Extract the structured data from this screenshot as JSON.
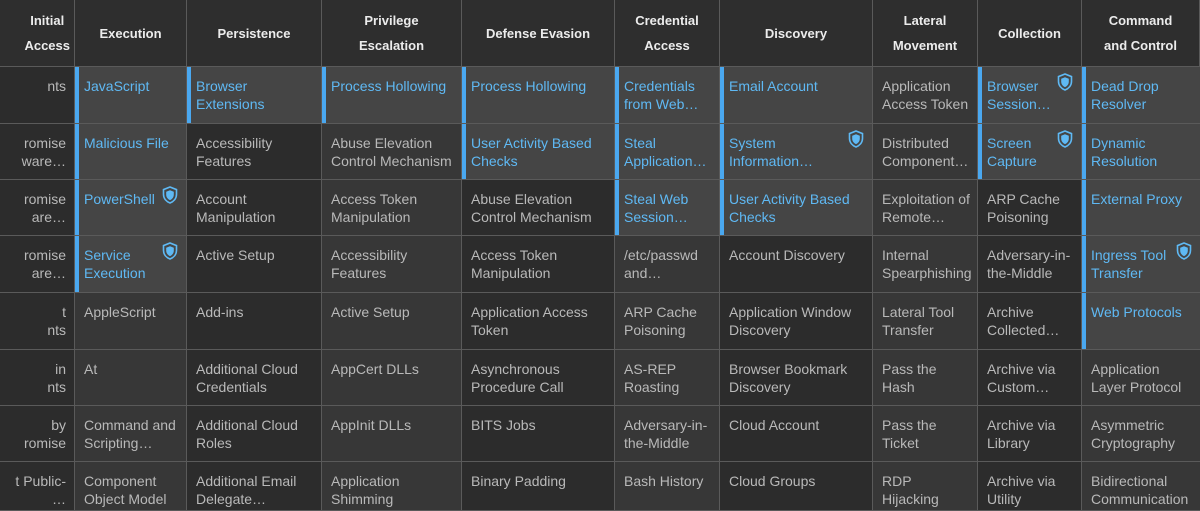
{
  "colors": {
    "highlight_text": "#5fb9f4",
    "highlight_bar": "#4aa8f0",
    "header_text": "#ececec",
    "cell_text": "#b9b9b9"
  },
  "headers": [
    "Initial\nAccess",
    "Execution",
    "Persistence",
    "Privilege\nEscalation",
    "Defense Evasion",
    "Credential\nAccess",
    "Discovery",
    "Lateral\nMovement",
    "Collection",
    "Command\nand Control"
  ],
  "rows": [
    {
      "cells": [
        {
          "text": "nts",
          "hl": false,
          "badge": false
        },
        {
          "text": "JavaScript",
          "hl": true,
          "badge": false
        },
        {
          "text": "Browser\nExtensions",
          "hl": true,
          "badge": false
        },
        {
          "text": "Process Hollowing",
          "hl": true,
          "badge": false
        },
        {
          "text": "Process Hollowing",
          "hl": true,
          "badge": false
        },
        {
          "text": "Credentials\nfrom Web…",
          "hl": true,
          "badge": false
        },
        {
          "text": "Email Account",
          "hl": true,
          "badge": false
        },
        {
          "text": "Application\nAccess Token",
          "hl": false,
          "badge": false
        },
        {
          "text": "Browser\nSession…",
          "hl": true,
          "badge": true
        },
        {
          "text": "Dead Drop\nResolver",
          "hl": true,
          "badge": false
        }
      ]
    },
    {
      "cells": [
        {
          "text": "romise\nware…",
          "hl": false,
          "badge": false
        },
        {
          "text": "Malicious File",
          "hl": true,
          "badge": false
        },
        {
          "text": "Accessibility\nFeatures",
          "hl": false,
          "badge": false
        },
        {
          "text": "Abuse Elevation\nControl Mechanism",
          "hl": false,
          "badge": false
        },
        {
          "text": "User Activity Based\nChecks",
          "hl": true,
          "badge": false
        },
        {
          "text": "Steal\nApplication…",
          "hl": true,
          "badge": false
        },
        {
          "text": "System\nInformation…",
          "hl": true,
          "badge": true
        },
        {
          "text": "Distributed\nComponent…",
          "hl": false,
          "badge": false
        },
        {
          "text": "Screen\nCapture",
          "hl": true,
          "badge": true
        },
        {
          "text": "Dynamic\nResolution",
          "hl": true,
          "badge": false
        }
      ]
    },
    {
      "cells": [
        {
          "text": "romise\nare…",
          "hl": false,
          "badge": false
        },
        {
          "text": "PowerShell",
          "hl": true,
          "badge": true
        },
        {
          "text": "Account\nManipulation",
          "hl": false,
          "badge": false
        },
        {
          "text": "Access Token\nManipulation",
          "hl": false,
          "badge": false
        },
        {
          "text": "Abuse Elevation\nControl Mechanism",
          "hl": false,
          "badge": false
        },
        {
          "text": "Steal Web\nSession…",
          "hl": true,
          "badge": false
        },
        {
          "text": "User Activity Based\nChecks",
          "hl": true,
          "badge": false
        },
        {
          "text": "Exploitation of\nRemote…",
          "hl": false,
          "badge": false
        },
        {
          "text": "ARP Cache\nPoisoning",
          "hl": false,
          "badge": false
        },
        {
          "text": "External Proxy",
          "hl": true,
          "badge": false
        }
      ]
    },
    {
      "cells": [
        {
          "text": "romise\nare…",
          "hl": false,
          "badge": false
        },
        {
          "text": "Service\nExecution",
          "hl": true,
          "badge": true
        },
        {
          "text": "Active Setup",
          "hl": false,
          "badge": false
        },
        {
          "text": "Accessibility\nFeatures",
          "hl": false,
          "badge": false
        },
        {
          "text": "Access Token\nManipulation",
          "hl": false,
          "badge": false
        },
        {
          "text": "/etc/passwd\nand…",
          "hl": false,
          "badge": false
        },
        {
          "text": "Account Discovery",
          "hl": false,
          "badge": false
        },
        {
          "text": "Internal\nSpearphishing",
          "hl": false,
          "badge": false
        },
        {
          "text": "Adversary-in-\nthe-Middle",
          "hl": false,
          "badge": false
        },
        {
          "text": "Ingress Tool\nTransfer",
          "hl": true,
          "badge": true
        }
      ]
    },
    {
      "cells": [
        {
          "text": "t\nnts",
          "hl": false,
          "badge": false
        },
        {
          "text": "AppleScript",
          "hl": false,
          "badge": false
        },
        {
          "text": "Add-ins",
          "hl": false,
          "badge": false
        },
        {
          "text": "Active Setup",
          "hl": false,
          "badge": false
        },
        {
          "text": "Application Access\nToken",
          "hl": false,
          "badge": false
        },
        {
          "text": "ARP Cache\nPoisoning",
          "hl": false,
          "badge": false
        },
        {
          "text": "Application Window\nDiscovery",
          "hl": false,
          "badge": false
        },
        {
          "text": "Lateral Tool\nTransfer",
          "hl": false,
          "badge": false
        },
        {
          "text": "Archive\nCollected…",
          "hl": false,
          "badge": false
        },
        {
          "text": "Web Protocols",
          "hl": true,
          "badge": false
        }
      ]
    },
    {
      "cells": [
        {
          "text": "in\nnts",
          "hl": false,
          "badge": false
        },
        {
          "text": "At",
          "hl": false,
          "badge": false
        },
        {
          "text": "Additional Cloud\nCredentials",
          "hl": false,
          "badge": false
        },
        {
          "text": "AppCert DLLs",
          "hl": false,
          "badge": false
        },
        {
          "text": "Asynchronous\nProcedure Call",
          "hl": false,
          "badge": false
        },
        {
          "text": "AS-REP\nRoasting",
          "hl": false,
          "badge": false
        },
        {
          "text": "Browser Bookmark\nDiscovery",
          "hl": false,
          "badge": false
        },
        {
          "text": "Pass the Hash",
          "hl": false,
          "badge": false
        },
        {
          "text": "Archive via\nCustom…",
          "hl": false,
          "badge": false
        },
        {
          "text": "Application\nLayer Protocol",
          "hl": false,
          "badge": false
        }
      ]
    },
    {
      "cells": [
        {
          "text": "by\nromise",
          "hl": false,
          "badge": false
        },
        {
          "text": "Command and\nScripting…",
          "hl": false,
          "badge": false
        },
        {
          "text": "Additional Cloud\nRoles",
          "hl": false,
          "badge": false
        },
        {
          "text": "AppInit DLLs",
          "hl": false,
          "badge": false
        },
        {
          "text": "BITS Jobs",
          "hl": false,
          "badge": false
        },
        {
          "text": "Adversary-in-\nthe-Middle",
          "hl": false,
          "badge": false
        },
        {
          "text": "Cloud Account",
          "hl": false,
          "badge": false
        },
        {
          "text": "Pass the Ticket",
          "hl": false,
          "badge": false
        },
        {
          "text": "Archive via\nLibrary",
          "hl": false,
          "badge": false
        },
        {
          "text": "Asymmetric\nCryptography",
          "hl": false,
          "badge": false
        }
      ]
    },
    {
      "cells": [
        {
          "text": "t Public-\n…",
          "hl": false,
          "badge": false
        },
        {
          "text": "Component\nObject Model",
          "hl": false,
          "badge": false
        },
        {
          "text": "Additional Email\nDelegate…",
          "hl": false,
          "badge": false
        },
        {
          "text": "Application\nShimming",
          "hl": false,
          "badge": false
        },
        {
          "text": "Binary Padding",
          "hl": false,
          "badge": false
        },
        {
          "text": "Bash History",
          "hl": false,
          "badge": false
        },
        {
          "text": "Cloud Groups",
          "hl": false,
          "badge": false
        },
        {
          "text": "RDP Hijacking",
          "hl": false,
          "badge": false
        },
        {
          "text": "Archive via\nUtility",
          "hl": false,
          "badge": false
        },
        {
          "text": "Bidirectional\nCommunication",
          "hl": false,
          "badge": false
        }
      ]
    }
  ]
}
